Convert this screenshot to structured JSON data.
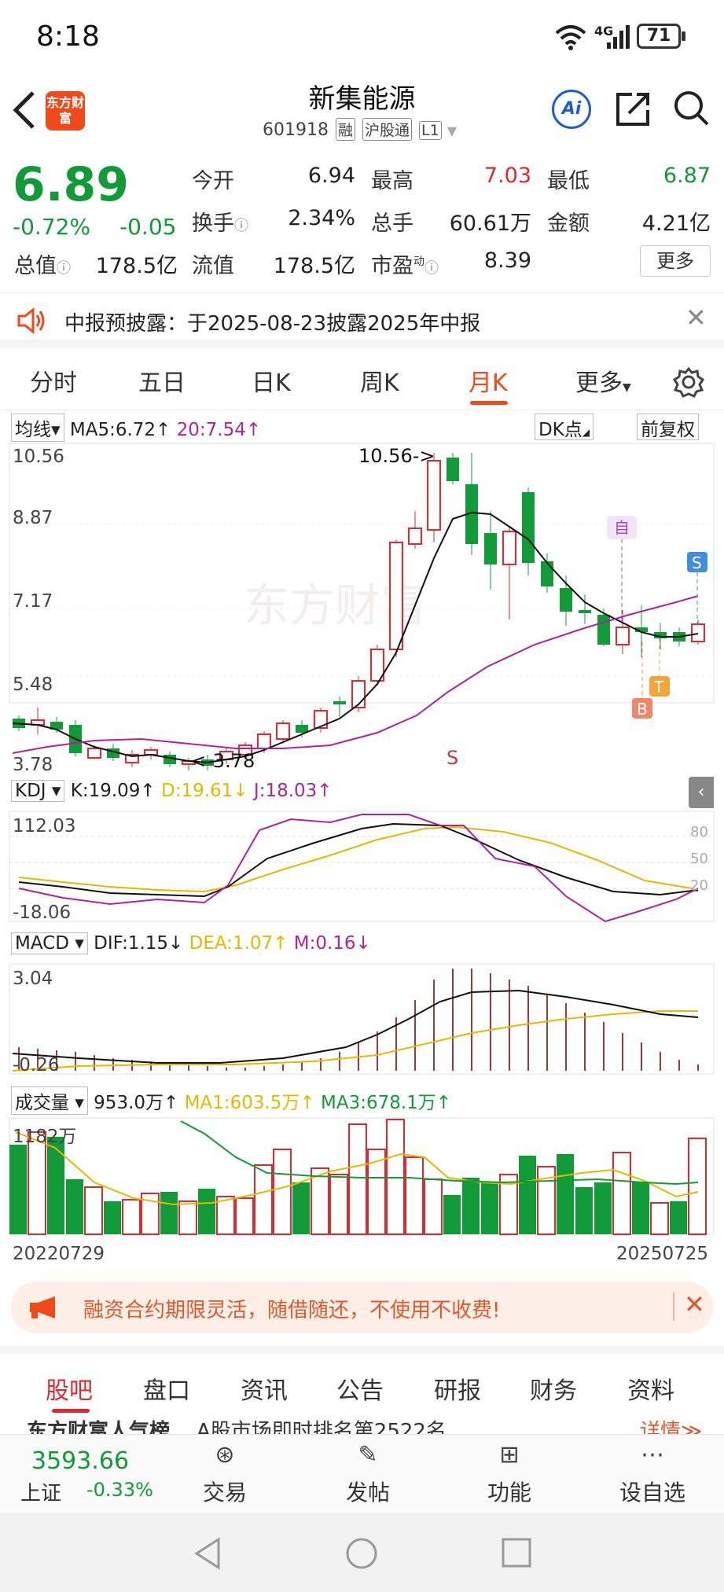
{
  "status": {
    "time": "8:18",
    "network": "4G",
    "battery": "71"
  },
  "header": {
    "logo_text": "东方财富",
    "title": "新集能源",
    "code": "601918",
    "tags": [
      "融",
      "沪股通",
      "L1"
    ],
    "ai_label": "Ai"
  },
  "quote": {
    "price": "6.89",
    "change_pct": "-0.72%",
    "change": "-0.05",
    "items": [
      {
        "label": "今开",
        "value": "6.94",
        "color": "normal"
      },
      {
        "label": "最高",
        "value": "7.03",
        "color": "red"
      },
      {
        "label": "最低",
        "value": "6.87",
        "color": "green"
      },
      {
        "label": "换手",
        "value": "2.34%",
        "color": "normal"
      },
      {
        "label": "总手",
        "value": "60.61万",
        "color": "normal"
      },
      {
        "label": "金额",
        "value": "4.21亿",
        "color": "normal"
      },
      {
        "label": "总值",
        "value": "178.5亿",
        "color": "normal"
      },
      {
        "label": "流值",
        "value": "178.5亿",
        "color": "normal"
      },
      {
        "label": "市盈",
        "value": "8.39",
        "color": "normal"
      }
    ],
    "pe_sup": "动",
    "more_label": "更多"
  },
  "notice": {
    "text": "中报预披露：于2025-08-23披露2025年中报"
  },
  "tabs": [
    "分时",
    "五日",
    "日K",
    "周K",
    "月K",
    "更多"
  ],
  "active_tab": "月K",
  "kline": {
    "ma_dropdown": "均线",
    "ma5": "MA5:6.72↑",
    "ma20": "20:7.54↑",
    "dk_label": "DK点",
    "fq_label": "前复权",
    "y_labels": [
      "10.56",
      "8.87",
      "7.17",
      "5.48",
      "3.78"
    ],
    "high_marker": "10.56->",
    "low_marker": "<-3.78",
    "watermark": "东方财富",
    "markers": {
      "zi": "自",
      "s": "S",
      "b": "B",
      "t": "T",
      "s_bottom": "S"
    }
  },
  "kdj": {
    "dropdown": "KDJ",
    "k": "K:19.09↑",
    "d": "D:19.61↓",
    "j": "J:18.03↑",
    "y_top": "112.03",
    "y_bottom": "-18.06",
    "levels": [
      "80",
      "50",
      "20"
    ]
  },
  "macd": {
    "dropdown": "MACD",
    "dif": "DIF:1.15↓",
    "dea": "DEA:1.07↑",
    "m": "M:0.16↓",
    "y_top": "3.04",
    "y_bottom": "-0.26"
  },
  "volume": {
    "dropdown": "成交量",
    "vol": "953.0万↑",
    "ma1": "MA1:603.5万↑",
    "ma3": "MA3:678.1万↑",
    "y_top": "1182万",
    "date_start": "20220729",
    "date_end": "20250725"
  },
  "promo": {
    "text": "融资合约期限灵活，随借随还，不使用不收费!"
  },
  "bottom_tabs": [
    "股吧",
    "盘口",
    "资讯",
    "公告",
    "研报",
    "财务",
    "资料"
  ],
  "active_bottom_tab": "股吧",
  "ticker": {
    "left": "东方财富人气榜",
    "mid": "A股市场即时排名第2522名",
    "right": "详情"
  },
  "bottom_bar": {
    "index_value": "3593.66",
    "index_name": "上证",
    "index_change": "-0.33%",
    "items": [
      "交易",
      "发帖",
      "功能",
      "设自选"
    ]
  },
  "colors": {
    "accent": "#f04a1a",
    "up": "#e0282e",
    "down": "#109b38",
    "ma_yellow": "#e6b800",
    "ma_purple": "#b0249a"
  }
}
